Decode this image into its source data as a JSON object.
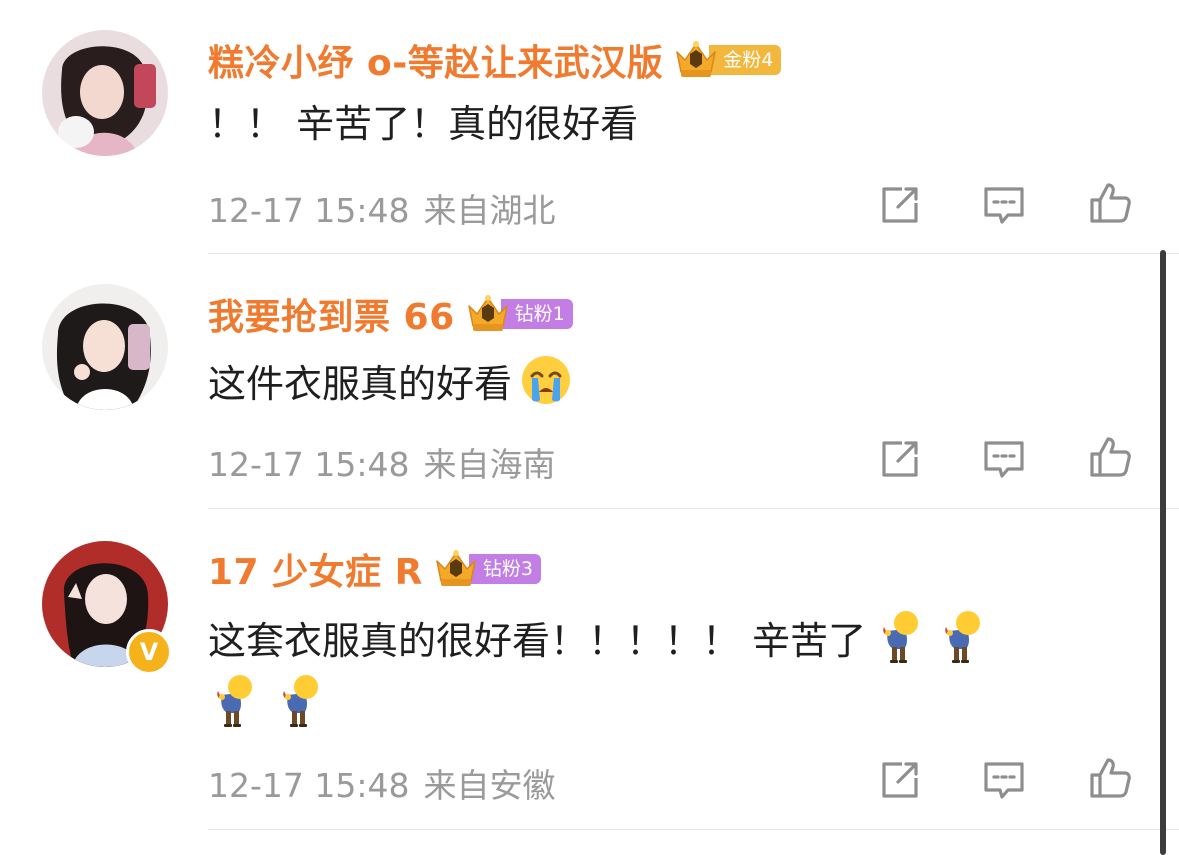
{
  "comments": [
    {
      "username": "糕冷小纾 o-等赵让来武汉版",
      "fan_badge": {
        "label": "金粉4",
        "tier": "gold",
        "crown_number": "13"
      },
      "text": "！！ 辛苦了！真的很好看",
      "time": "12-17 15:48",
      "location": "来自湖北",
      "verified": false
    },
    {
      "username": "我要抢到票 66",
      "fan_badge": {
        "label": "钻粉1",
        "tier": "diamond",
        "crown_number": "13"
      },
      "text": "这件衣服真的好看",
      "emoji": "crying-face-emoji",
      "time": "12-17 15:48",
      "location": "来自海南",
      "verified": false
    },
    {
      "username": "17 少女症 R",
      "fan_badge": {
        "label": "钻粉3",
        "tier": "diamond",
        "crown_number": "16"
      },
      "text": "这套衣服真的很好看！！！！！ 辛苦了",
      "emoji": "bowing-person-emoji",
      "emoji_count_line1": 2,
      "emoji_count_line2": 2,
      "time": "12-17 15:48",
      "location": "来自安徽",
      "verified": true,
      "verified_badge": "V"
    }
  ],
  "actions": [
    "share-icon",
    "comment-icon",
    "like-icon"
  ],
  "colors": {
    "username": "#f07a2e",
    "text": "#1f1f1f",
    "meta": "#9a9a9a",
    "gold_badge": "#f2b73c",
    "diamond_badge": "#c37ee6",
    "verified": "#f6b21a"
  }
}
